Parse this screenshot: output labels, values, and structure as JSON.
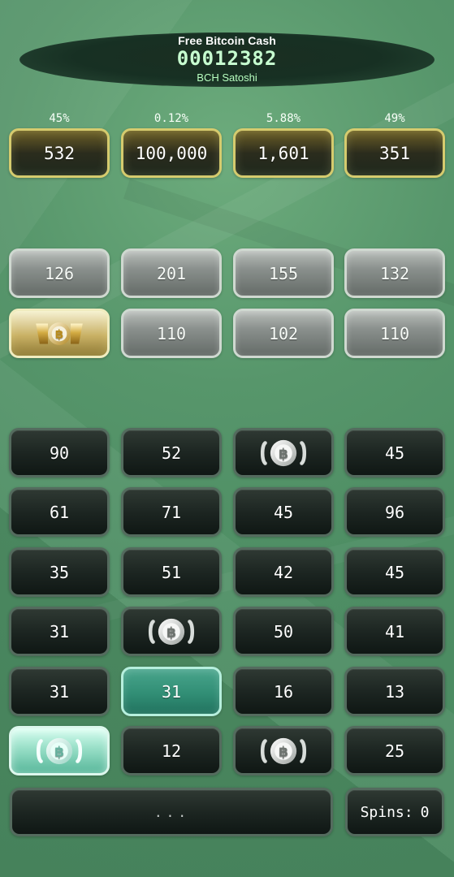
{
  "header": {
    "title": "Free Bitcoin Cash",
    "balance": "00012382",
    "unit": "BCH Satoshi"
  },
  "jackpot": {
    "percentages": [
      "45%",
      "0.12%",
      "5.88%",
      "49%"
    ],
    "values": [
      "532",
      "100,000",
      "1,601",
      "351"
    ]
  },
  "mid_grid": {
    "row1": [
      "126",
      "201",
      "155",
      "132"
    ],
    "row2": [
      "coin",
      "110",
      "102",
      "110"
    ]
  },
  "main_grid": {
    "rows": [
      [
        "90",
        "52",
        "coin",
        "45"
      ],
      [
        "61",
        "71",
        "45",
        "96"
      ],
      [
        "35",
        "51",
        "42",
        "45"
      ],
      [
        "31",
        "coin",
        "50",
        "41"
      ],
      [
        "31",
        "31",
        "16",
        "13"
      ],
      [
        "coin",
        "12",
        "coin",
        "25"
      ]
    ]
  },
  "footer": {
    "message": "...",
    "spins_label": "Spins:",
    "spins_value": "0"
  },
  "icons": {
    "coin_gold": "bitcoin-cash-gold-icon",
    "coin_silver": "bitcoin-cash-silver-icon",
    "coin_teal": "bitcoin-cash-teal-icon"
  },
  "colors": {
    "background": "#4e8e64",
    "header": "#173023",
    "gold": "#d5cb6e",
    "silver": "#cfd8d0",
    "dark": "#1c2521",
    "teal": "#318e75",
    "balance_text": "#c7ffd0"
  }
}
